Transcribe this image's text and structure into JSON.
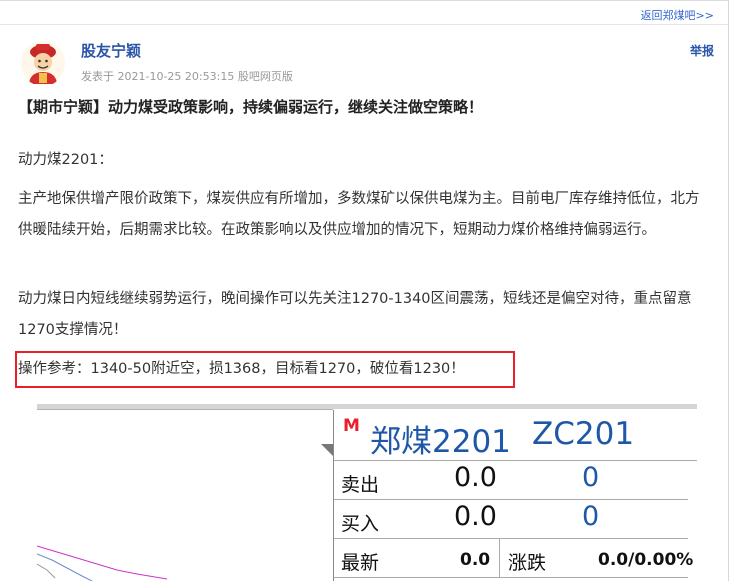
{
  "header": {
    "back_link": "返回郑煤吧>>"
  },
  "post": {
    "author": "股友宁颖",
    "meta": "发表于 2021-10-25 20:53:15 股吧网页版",
    "report": "举报",
    "title": "【期市宁颖】动力煤受政策影响，持续偏弱运行，继续关注做空策略！",
    "para1": "动力煤2201：",
    "para2": "主产地保供增产限价政策下，煤炭供应有所增加，多数煤矿以保供电煤为主。目前电厂库存维持低位，北方供暖陆续开始，后期需求比较。在政策影响以及供应增加的情况下，短期动力煤价格维持偏弱运行。",
    "para3": "动力煤日内短线继续弱势运行，晚间操作可以先关注1270-1340区间震荡，短线还是偏空对待，重点留意1270支撑情况！",
    "operation": "操作参考：1340-50附近空，损1368，目标看1270，破位看1230！"
  },
  "quote": {
    "badge": "M",
    "name": "郑煤2201",
    "code": "ZC201",
    "rows": [
      {
        "label": "卖出",
        "value": "0.0",
        "volume": "0"
      },
      {
        "label": "买入",
        "value": "0.0",
        "volume": "0"
      }
    ],
    "last_label": "最新",
    "last_value": "0.0",
    "change_label": "涨跌",
    "change_value": "0.0/0.00%"
  },
  "colors": {
    "accent_blue": "#1f57a8",
    "link_blue": "#3366cc",
    "highlight_red": "#e8202a"
  }
}
